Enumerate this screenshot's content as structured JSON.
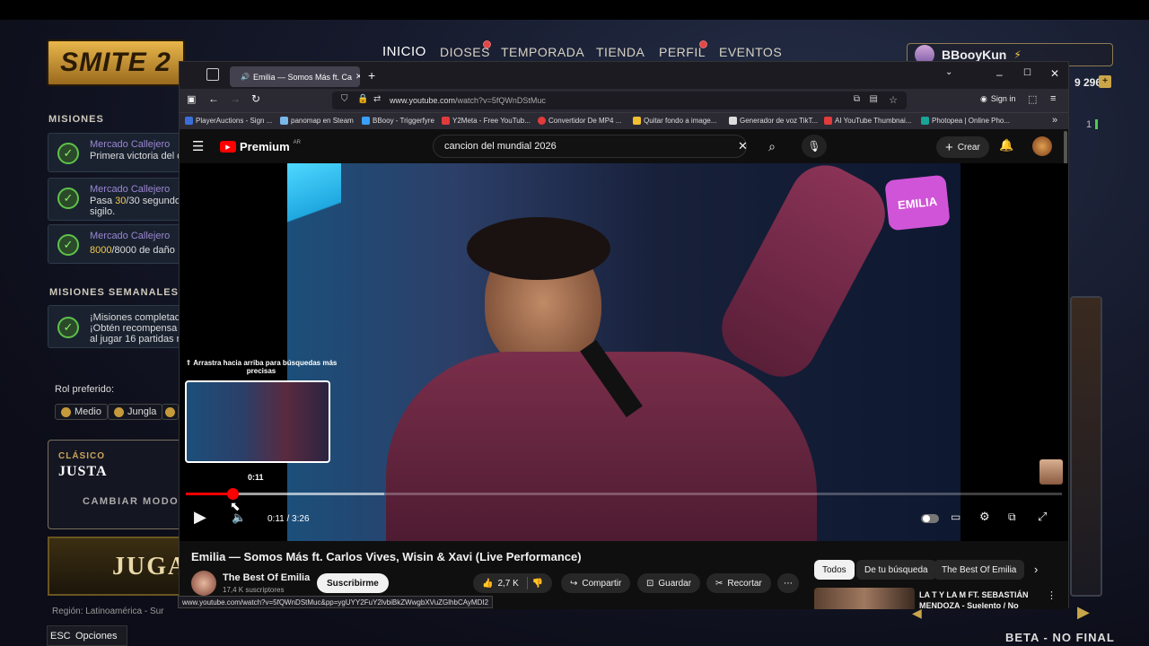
{
  "game": {
    "nav": [
      "INICIO",
      "DIOSES",
      "TEMPORADA",
      "TIENDA",
      "PERFIL",
      "EVENTOS"
    ],
    "logo": "SMITE 2",
    "username": "BBooyKun",
    "currency": "9 296",
    "side_count": "1",
    "missions_title": "MISIONES",
    "missions": [
      {
        "title": "Mercado Callejero",
        "desc_a": "Primera victoria del d",
        "desc_b": "",
        "desc_hl": ""
      },
      {
        "title": "Mercado Callejero",
        "desc_a": "Pasa ",
        "desc_hl": "30",
        "desc_b": "/30 segundo",
        "desc_c": "sigilo."
      },
      {
        "title": "Mercado Callejero",
        "desc_a": "",
        "desc_hl": "8000",
        "desc_b": "/8000 de daño"
      }
    ],
    "weekly_title": "MISIONES SEMANALES",
    "weekly": {
      "l1": "¡Misiones completad",
      "l2": "¡Obtén recompensa",
      "l3": "al jugar 16 partidas r"
    },
    "role_label": "Rol preferido:",
    "roles": [
      "Medio",
      "Jungla"
    ],
    "mode_kicker": "CLÁSICO",
    "mode_name": "JUSTA",
    "change_mode": "CAMBIAR MODO",
    "play": "JUGA",
    "region": "Región: Latinoamérica - Sur",
    "esc": "ESC",
    "options": "Opciones",
    "bottom_right": "BETA - NO FINAL"
  },
  "browser": {
    "tab_title": "Emilia — Somos Más ft. Ca",
    "url_prefix": "www.youtube.com",
    "url_rest": "/watch?v=5fQWnDStMuc",
    "sign_in": "Sign in",
    "bookmarks": [
      {
        "label": "PlayerAuctions - Sign ...",
        "color": "#3a6fd8"
      },
      {
        "label": "panomap en Steam",
        "color": "#7ab8e8"
      },
      {
        "label": "BBooy - Triggerfyre",
        "color": "#3aa0ff"
      },
      {
        "label": "Y2Meta - Free YouTub...",
        "color": "#e23b3b"
      },
      {
        "label": "Convertidor De MP4 ...",
        "color": "#e23b3b"
      },
      {
        "label": "Quitar fondo a image...",
        "color": "#f0c030"
      },
      {
        "label": "Generador de voz TikT...",
        "color": "#dddddd"
      },
      {
        "label": "AI YouTube Thumbnai...",
        "color": "#e23b3b"
      },
      {
        "label": "Photopea | Online Pho...",
        "color": "#18a497"
      }
    ]
  },
  "youtube": {
    "brand": "Premium",
    "brand_region": "AR",
    "search_query": "cancion del mundial 2026",
    "create": "Crear",
    "hint": "Arrastra hacia arriba para búsquedas más precisas",
    "preview_time": "0:11",
    "time": "0:11 / 3:26",
    "progress": 0.053,
    "buffered": 0.226,
    "title": "Emilia — Somos Más ft. Carlos Vives, Wisin & Xavi (Live Performance)",
    "channel": "The Best Of Emilia",
    "subscribers": "17,4 K suscriptores",
    "subscribe": "Suscribirme",
    "likes": "2,7 K",
    "share": "Compartir",
    "save": "Guardar",
    "clip": "Recortar",
    "filters": [
      "Todos",
      "De tu búsqueda",
      "The Best Of Emilia"
    ],
    "rec_title_1": "LA T Y LA M FT. SEBASTIÁN",
    "rec_title_2": "MENDOZA - Suelento / No",
    "status_url": "www.youtube.com/watch?v=5fQWnDStMuc&pp=ygUYY2FuY2lvbiBkZWwgbXVuZGlhbCAyMDI2",
    "logo_text": "EMILIA"
  }
}
